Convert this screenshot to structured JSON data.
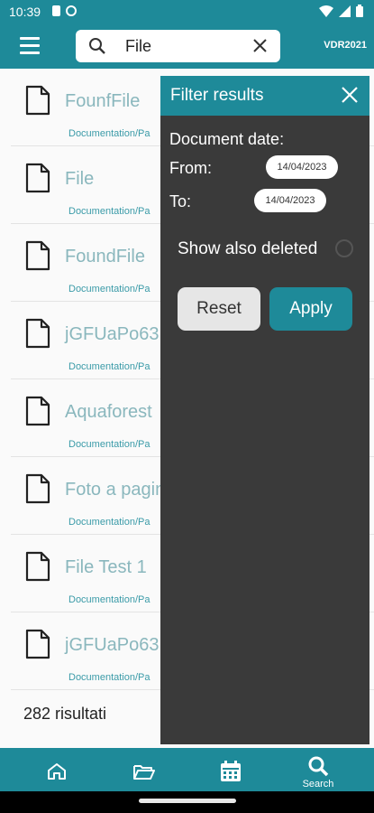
{
  "status_bar": {
    "time": "10:39"
  },
  "app_bar": {
    "search": {
      "value": "File"
    },
    "title": "VDR2021"
  },
  "results": {
    "items": [
      {
        "name": "FounfFile",
        "path": "Documentation/Pa"
      },
      {
        "name": "File",
        "path": "Documentation/Pa"
      },
      {
        "name": "FoundFile",
        "path": "Documentation/Pa"
      },
      {
        "name": "jGFUaPo63",
        "path": "Documentation/Pa"
      },
      {
        "name": "Aquaforest",
        "path": "Documentation/Pa"
      },
      {
        "name": "Foto a pagin",
        "path": "Documentation/Pa"
      },
      {
        "name": "File Test 1",
        "path": "Documentation/Pa"
      },
      {
        "name": "jGFUaPo63",
        "path": "Documentation/Pa"
      }
    ],
    "count_label": "282 risultati"
  },
  "filter": {
    "title": "Filter results",
    "document_date_label": "Document date:",
    "from_label": "From:",
    "from_value": "14/04/2023",
    "to_label": "To:",
    "to_value": "14/04/2023",
    "show_deleted_label": "Show also deleted",
    "reset_label": "Reset",
    "apply_label": "Apply"
  },
  "bottom_nav": {
    "search_label": "Search"
  },
  "colors": {
    "accent": "#1e8a99",
    "panel": "#3a3a3a",
    "file_name": "#8ab7bd",
    "file_path": "#3b9ba8"
  }
}
